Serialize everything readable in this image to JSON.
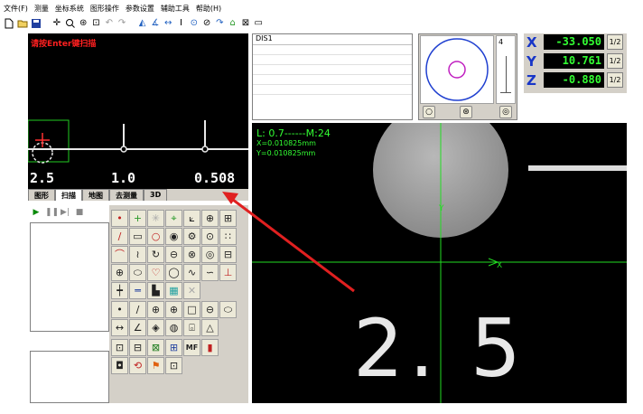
{
  "menu": [
    "文件(F)",
    "测量",
    "坐标系统",
    "图形操作",
    "参数设置",
    "辅助工具",
    "帮助(H)"
  ],
  "scan": {
    "hint": "请按Enter键扫描",
    "readout_left": "2.5",
    "readout_mid": "1.0",
    "readout_right": "0.508"
  },
  "tabs": [
    {
      "label": "图形",
      "active": false
    },
    {
      "label": "扫描",
      "active": true
    },
    {
      "label": "地图",
      "active": false
    },
    {
      "label": "去测量",
      "active": false
    },
    {
      "label": "3D",
      "active": false
    }
  ],
  "dis1": {
    "title": "DIS1"
  },
  "mini": {
    "slider_label": "4"
  },
  "dro": {
    "x": {
      "axis": "X",
      "value": "-33.050",
      "half": "1/2"
    },
    "y": {
      "axis": "Y",
      "value": "10.761",
      "half": "1/2"
    },
    "z": {
      "axis": "Z",
      "value": "-0.880",
      "half": "1/2"
    }
  },
  "camera": {
    "header": "L: 0.7------M:24",
    "x_line": "X=0.010825mm",
    "y_line": "Y=0.010825mm",
    "axis_y": "Y",
    "axis_x": "X",
    "digits": "2. 5"
  },
  "palette_text": {
    "mf": "MF"
  },
  "colors": {
    "crosshair": "#22dd22",
    "dro_text": "#33ff33",
    "axis_label": "#1836c8",
    "annotation_arrow": "#e02020",
    "hint": "#ff2020"
  }
}
